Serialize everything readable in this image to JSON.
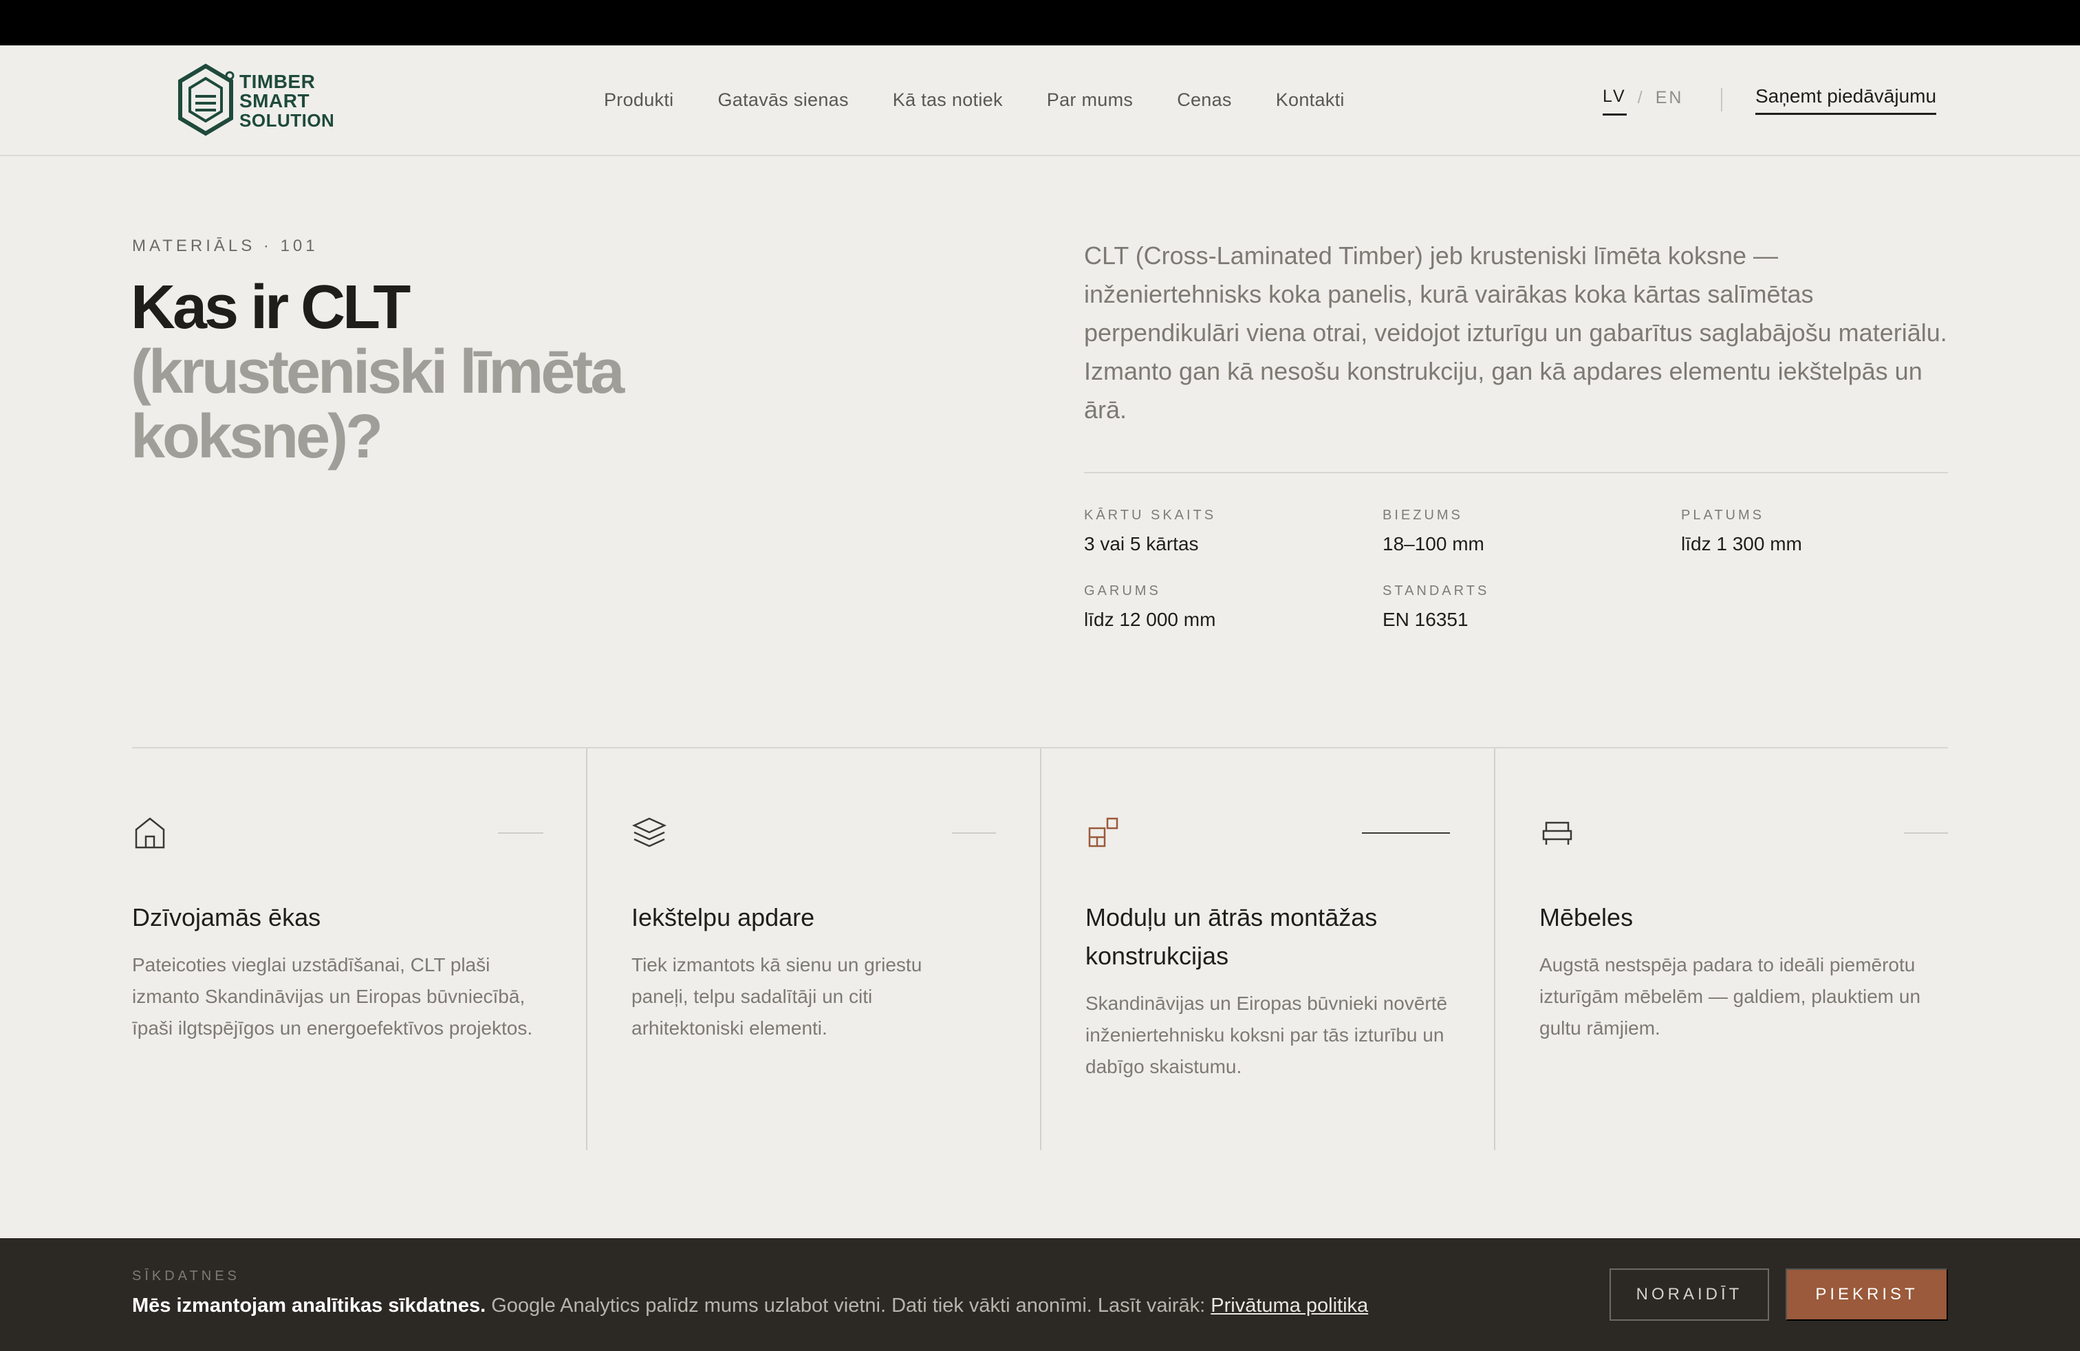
{
  "brand": {
    "line1": "TIMBER",
    "line2": "SMART",
    "line3": "SOLUTION"
  },
  "nav": [
    "Produkti",
    "Gatavās sienas",
    "Kā tas notiek",
    "Par mums",
    "Cenas",
    "Kontakti"
  ],
  "lang": {
    "active": "LV",
    "separator": "/",
    "other": "EN"
  },
  "cta": "Saņemt piedāvājumu",
  "hero": {
    "eyebrow": "MATERIĀLS · 101",
    "title_dark": "Kas ir CLT",
    "title_muted": "(krusteniski līmēta koksne)?",
    "lead": "CLT (Cross-Laminated Timber) jeb krusteniski līmēta koksne — inženiertehnisks koka panelis, kurā vairākas koka kārtas salīmētas perpendikulāri viena otrai, veidojot izturīgu un gabarītus saglabājošu materiālu. Izmanto gan kā nesošu konstrukciju, gan kā apdares elementu iekštelpās un ārā."
  },
  "specs": [
    {
      "label": "KĀRTU SKAITS",
      "value": "3 vai 5 kārtas"
    },
    {
      "label": "BIEZUMS",
      "value": "18–100 mm"
    },
    {
      "label": "PLATUMS",
      "value": "līdz 1 300 mm"
    },
    {
      "label": "GARUMS",
      "value": "līdz 12 000 mm"
    },
    {
      "label": "STANDARTS",
      "value": "EN 16351"
    }
  ],
  "cards": [
    {
      "icon": "house-icon",
      "title": "Dzīvojamās ēkas",
      "text": "Pateicoties vieglai uzstādīšanai, CLT plaši izmanto Skandināvijas un Eiropas būvniecībā, īpaši ilgtspējīgos un energoefektīvos projektos."
    },
    {
      "icon": "layers-icon",
      "title": "Iekštelpu apdare",
      "text": "Tiek izmantots kā sienu un griestu paneļi, telpu sadalītāji un citi arhitektoniski elementi."
    },
    {
      "icon": "modules-icon",
      "title": "Moduļu un ātrās montāžas konstrukcijas",
      "text": "Skandināvijas un Eiropas būvnieki novērtē inženiertehnisku koksni par tās izturību un dabīgo skaistumu."
    },
    {
      "icon": "bed-icon",
      "title": "Mēbeles",
      "text": "Augstā nestspēja padara to ideāli piemērotu izturīgām mēbelēm — galdiem, plauktiem un gultu rāmjiem."
    }
  ],
  "cookie": {
    "eyebrow": "SĪKDATNES",
    "strong": "Mēs izmantojam analītikas sīkdatnes.",
    "text": " Google Analytics palīdz mums uzlabot vietni. Dati tiek vākti anonīmi. Lasīt vairāk: ",
    "link": "Privātuma politika",
    "reject": "NORAIDĪT",
    "accept": "PIEKRIST"
  },
  "colors": {
    "background": "#efeeea",
    "brand_green": "#1e4a3c",
    "accent": "#9a5a3b",
    "cookie_bg": "#2c2925"
  }
}
